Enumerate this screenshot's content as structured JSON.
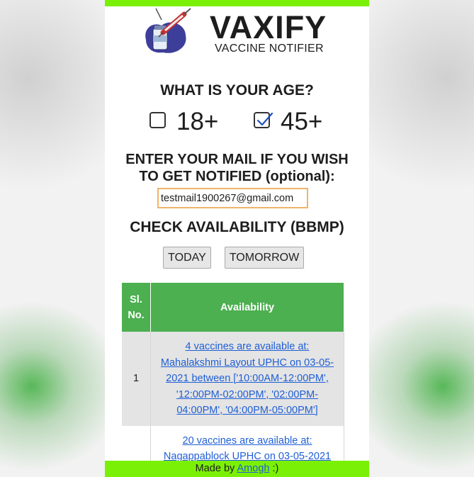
{
  "header": {
    "brand": "VAXIFY",
    "tagline": "VACCINE NOTIFIER"
  },
  "age_question": "WHAT IS YOUR AGE?",
  "age_options": [
    {
      "label": "18+",
      "checked": false
    },
    {
      "label": "45+",
      "checked": true
    }
  ],
  "mail": {
    "prompt_line1": "ENTER YOUR MAIL IF YOU WISH",
    "prompt_line2": "TO GET NOTIFIED (optional):",
    "value": "testmail1900267@gmail.com"
  },
  "availability": {
    "title": "CHECK AVAILABILITY (BBMP)",
    "today_label": "TODAY",
    "tomorrow_label": "TOMORROW"
  },
  "table": {
    "col_sl_line1": "Sl.",
    "col_sl_line2": "No.",
    "col_availability": "Availability",
    "rows": [
      {
        "sl": "1",
        "lines": [
          "4 vaccines are available at:",
          "Mahalakshmi Layout UPHC on 03-05-",
          "2021 between ['10:00AM-12:00PM',",
          "'12:00PM-02:00PM', '02:00PM-",
          "04:00PM', '04:00PM-05:00PM']"
        ]
      },
      {
        "sl": "",
        "lines": [
          "20 vaccines are available at:",
          "Nagappablock UPHC on 03-05-2021"
        ]
      }
    ]
  },
  "footer": {
    "prefix": "Made by ",
    "author": "Amogh",
    "suffix": " :)"
  },
  "colors": {
    "accent_green": "#7bf007",
    "table_header_green": "#4caf50",
    "link_blue": "#1f5fd6"
  }
}
